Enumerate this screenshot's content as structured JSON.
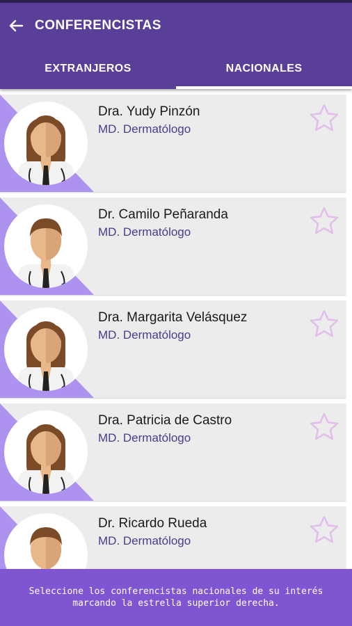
{
  "app_bar": {
    "title": "CONFERENCISTAS",
    "back_icon": "arrow-left-icon"
  },
  "tabs": [
    {
      "label": "EXTRANJEROS",
      "active": false
    },
    {
      "label": "NACIONALES",
      "active": true
    }
  ],
  "speakers": [
    {
      "name": "Dra. Yudy Pinzón",
      "specialty": "MD. Dermatólogo",
      "gender": "female",
      "favorite": false
    },
    {
      "name": "Dr. Camilo Peñaranda",
      "specialty": "MD. Dermatólogo",
      "gender": "male",
      "favorite": false
    },
    {
      "name": "Dra. Margarita Velásquez",
      "specialty": "MD. Dermatólogo",
      "gender": "female",
      "favorite": false
    },
    {
      "name": "Dra. Patricia de Castro",
      "specialty": "MD. Dermatólogo",
      "gender": "female",
      "favorite": false
    },
    {
      "name": "Dr. Ricardo Rueda",
      "specialty": "MD. Dermatólogo",
      "gender": "male",
      "favorite": false
    }
  ],
  "footer": {
    "line1": "Seleccione los conferencistas nacionales de su interés",
    "line2": "marcando la estrella superior derecha."
  },
  "colors": {
    "primary": "#5a3f98",
    "accent": "#7f55d2",
    "triangle": "#ad92f0",
    "star": "#e2bfea",
    "card": "#ececec"
  }
}
